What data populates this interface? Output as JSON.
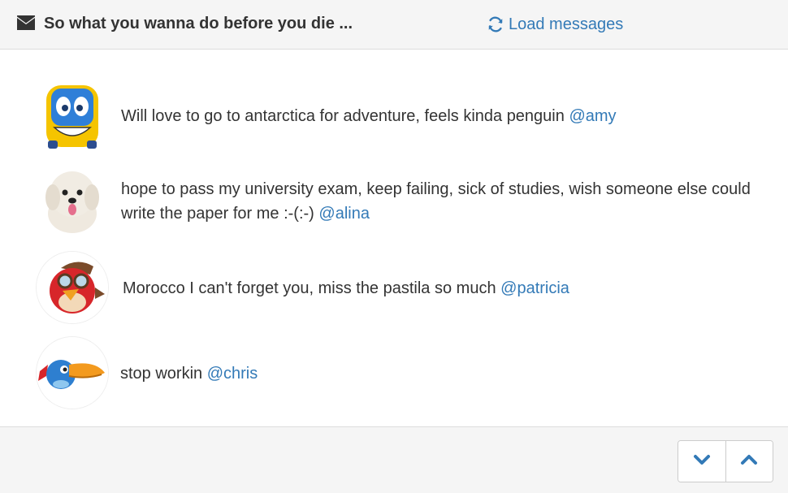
{
  "header": {
    "title": "So what you wanna do before you die ...",
    "title_icon": "envelope-icon",
    "load_label": "Load messages",
    "load_icon": "refresh-icon"
  },
  "messages": [
    {
      "text": "Will love to go to antarctica for adventure, feels kinda penguin ",
      "mention": "@amy",
      "avatar": "bus-avatar"
    },
    {
      "text": "hope to pass my university exam, keep failing, sick of studies, wish someone else could write the paper for me :-(:-) ",
      "mention": "@alina",
      "avatar": "dog-avatar"
    },
    {
      "text": "Morocco I can't forget you, miss the pastila so much ",
      "mention": "@patricia",
      "avatar": "red-bird-avatar"
    },
    {
      "text": "stop workin ",
      "mention": "@chris",
      "avatar": "blue-toucan-avatar"
    }
  ],
  "footer": {
    "down_icon": "chevron-down-icon",
    "up_icon": "chevron-up-icon"
  },
  "colors": {
    "link": "#337ab7",
    "heading_bg": "#f5f5f5",
    "text": "#333333"
  }
}
